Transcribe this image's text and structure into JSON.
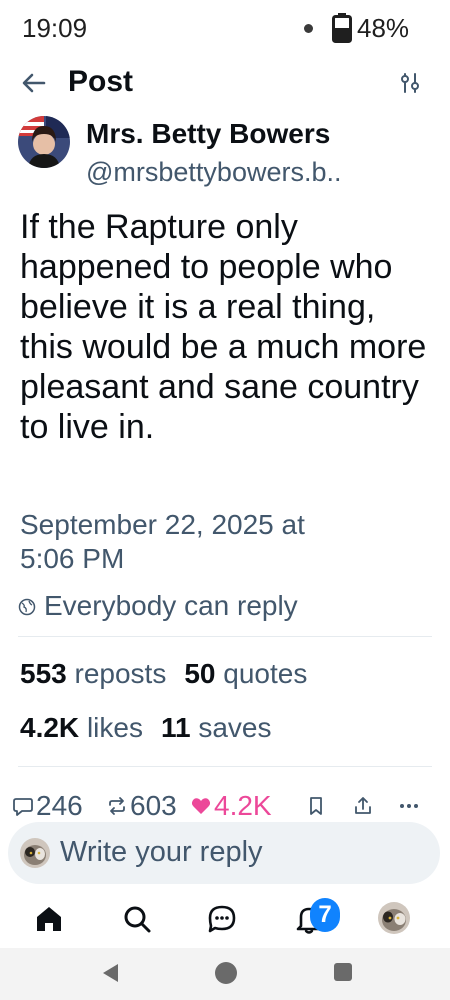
{
  "status_bar": {
    "time": "19:09",
    "battery": "48%"
  },
  "header": {
    "title": "Post"
  },
  "post": {
    "author_name": "Mrs. Betty Bowers",
    "author_handle": "@mrsbettybowers.b..",
    "text": "If the Rapture only happened to people who believe it is a real thing, this would be a much more pleasant and sane country to live in.",
    "date_line1": "September 22, 2025 at",
    "date_line2": "5:06 PM",
    "reply_setting": "Everybody can reply"
  },
  "stats": {
    "reposts_count": "553",
    "reposts_label": "reposts",
    "quotes_count": "50",
    "quotes_label": "quotes",
    "likes_count": "4.2K",
    "likes_label": "likes",
    "saves_count": "11",
    "saves_label": "saves"
  },
  "actions": {
    "replies": "246",
    "reposts": "603",
    "likes": "4.2K"
  },
  "reply_bar": {
    "placeholder": "Write your reply"
  },
  "tab_bar": {
    "notification_badge": "7"
  },
  "colors": {
    "accent": "#1083fe",
    "like": "#ec4899",
    "muted": "#42576c"
  }
}
